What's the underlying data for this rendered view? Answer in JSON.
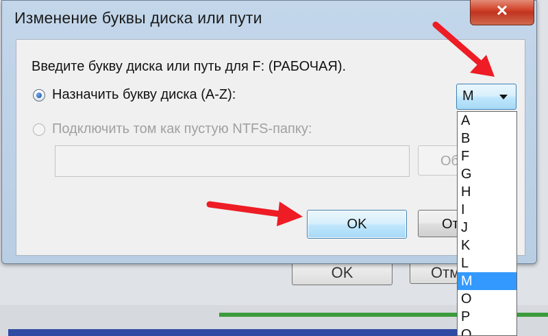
{
  "dialog": {
    "title": "Изменение буквы диска или пути",
    "close_glyph": "✕",
    "prompt": "Введите букву диска или путь для F: (РАБОЧАЯ).",
    "assign_option_label": "Назначить букву диска (A-Z):",
    "mount_option_label": "Подключить том как пустую NTFS-папку:",
    "path_value": "",
    "browse_label": "Обзор...",
    "ok_label": "OK",
    "cancel_label": "Отмена"
  },
  "drive_letter": {
    "selected_value": "M",
    "options": [
      "A",
      "B",
      "F",
      "G",
      "H",
      "I",
      "J",
      "K",
      "L",
      "M",
      "O",
      "P",
      "Q"
    ],
    "highlighted_index": 9
  },
  "background_window": {
    "ok_label": "OK",
    "cancel_label": "Отмена"
  },
  "colors": {
    "annotation_arrow": "#ee1c24",
    "selection_highlight": "#3399ff",
    "close_button": "#c9402a"
  }
}
